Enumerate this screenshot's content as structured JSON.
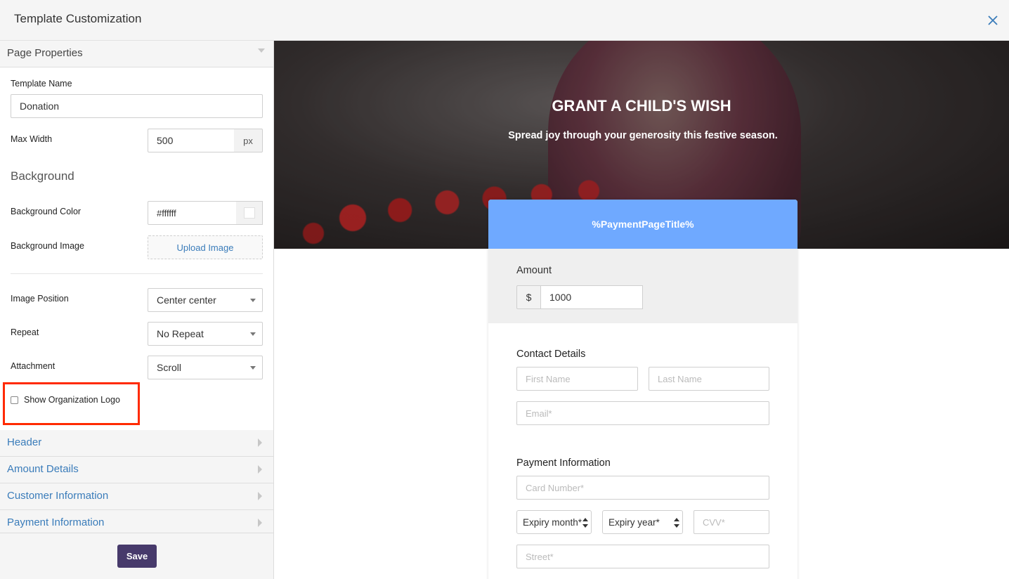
{
  "window": {
    "title": "Template Customization",
    "close_icon": "close-icon"
  },
  "panel": {
    "page_properties": {
      "heading": "Page Properties",
      "template_name_label": "Template Name",
      "template_name_value": "Donation",
      "max_width_label": "Max Width",
      "max_width_value": "500",
      "max_width_unit": "px",
      "background_heading": "Background",
      "bg_color_label": "Background Color",
      "bg_color_value": "#ffffff",
      "bg_image_label": "Background Image",
      "upload_label": "Upload Image",
      "image_position_label": "Image Position",
      "image_position_value": "Center center",
      "repeat_label": "Repeat",
      "repeat_value": "No Repeat",
      "attachment_label": "Attachment",
      "attachment_value": "Scroll",
      "show_logo_label": "Show Organization Logo",
      "show_logo_checked": false
    },
    "sections": [
      {
        "label": "Header"
      },
      {
        "label": "Amount Details"
      },
      {
        "label": "Customer Information"
      },
      {
        "label": "Payment Information"
      }
    ],
    "save_label": "Save"
  },
  "preview": {
    "hero_title": "GRANT A CHILD'S WISH",
    "hero_subtitle": "Spread joy through your generosity this festive season.",
    "card_title": "%PaymentPageTitle%",
    "amount_label": "Amount",
    "currency": "$",
    "amount_value": "1000",
    "contact_heading": "Contact Details",
    "first_name_placeholder": "First Name",
    "last_name_placeholder": "Last Name",
    "email_placeholder": "Email*",
    "payment_heading": "Payment Information",
    "card_number_placeholder": "Card Number*",
    "expiry_month": "Expiry month*",
    "expiry_year": "Expiry year*",
    "cvv_placeholder": "CVV*",
    "street_placeholder": "Street*"
  },
  "colors": {
    "accent_blue": "#6fa9ff",
    "save_button": "#473a6b",
    "link_blue": "#3a7cba",
    "highlight_red": "#ff2a00"
  }
}
